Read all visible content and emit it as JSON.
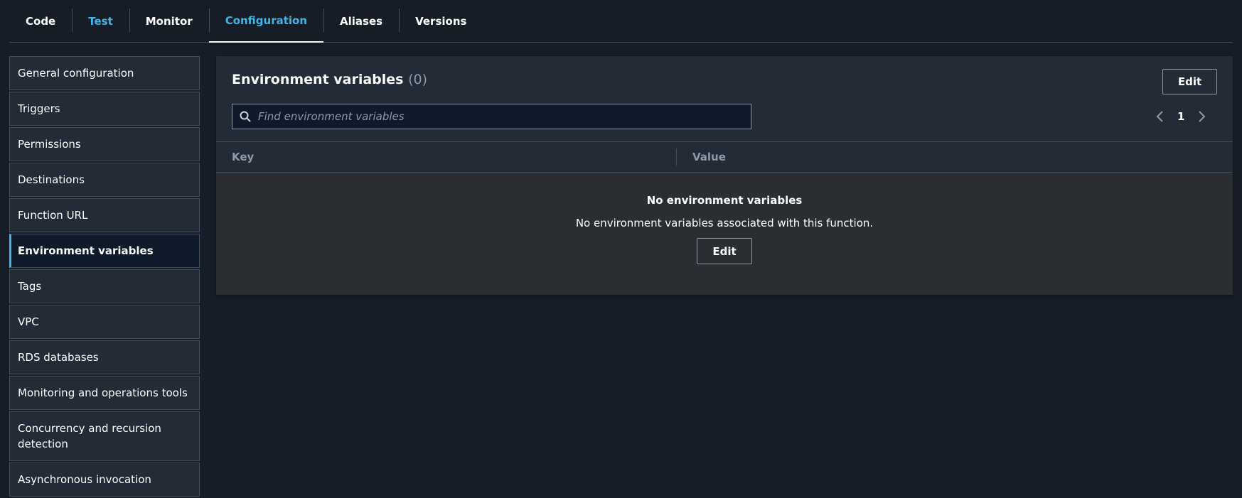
{
  "tabs": [
    {
      "label": "Code"
    },
    {
      "label": "Test"
    },
    {
      "label": "Monitor"
    },
    {
      "label": "Configuration"
    },
    {
      "label": "Aliases"
    },
    {
      "label": "Versions"
    }
  ],
  "sidebar": {
    "items": [
      {
        "label": "General configuration"
      },
      {
        "label": "Triggers"
      },
      {
        "label": "Permissions"
      },
      {
        "label": "Destinations"
      },
      {
        "label": "Function URL"
      },
      {
        "label": "Environment variables"
      },
      {
        "label": "Tags"
      },
      {
        "label": "VPC"
      },
      {
        "label": "RDS databases"
      },
      {
        "label": "Monitoring and operations tools"
      },
      {
        "label": "Concurrency and recursion detection"
      },
      {
        "label": "Asynchronous invocation"
      }
    ]
  },
  "panel": {
    "title": "Environment variables",
    "count": "(0)",
    "edit_label": "Edit",
    "search": {
      "placeholder": "Find environment variables",
      "value": ""
    },
    "pagination": {
      "current_page": "1"
    },
    "columns": [
      "Key",
      "Value"
    ],
    "empty": {
      "title": "No environment variables",
      "description": "No environment variables associated with this function.",
      "edit_label": "Edit"
    }
  },
  "colors": {
    "background": "#161d26",
    "panel": "#232b37",
    "accent": "#42b4e6",
    "border": "#414d5c"
  },
  "icons": [
    "search-icon",
    "chevron-left-icon",
    "chevron-right-icon"
  ]
}
